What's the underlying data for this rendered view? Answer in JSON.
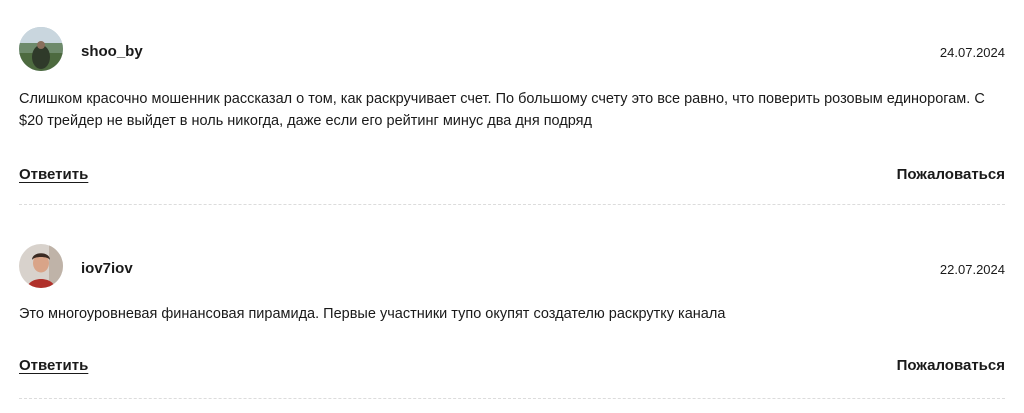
{
  "comments": [
    {
      "username": "shoo_by",
      "date": "24.07.2024",
      "text": "Слишком красочно мошенник рассказал о том, как раскручивает счет. По большому счету это все равно, что поверить розовым единорогам. С $20 трейдер не выйдет в ноль никогда, даже если его рейтинг минус два дня подряд",
      "reply_label": "Ответить",
      "report_label": "Пожаловаться"
    },
    {
      "username": "iov7iov",
      "date": "22.07.2024",
      "text": "Это многоуровневая финансовая пирамида. Первые участники тупо окупят создателю раскрутку канала",
      "reply_label": "Ответить",
      "report_label": "Пожаловаться"
    }
  ],
  "colors": {
    "text": "#1a1a1a",
    "divider": "#dcdcdc"
  }
}
